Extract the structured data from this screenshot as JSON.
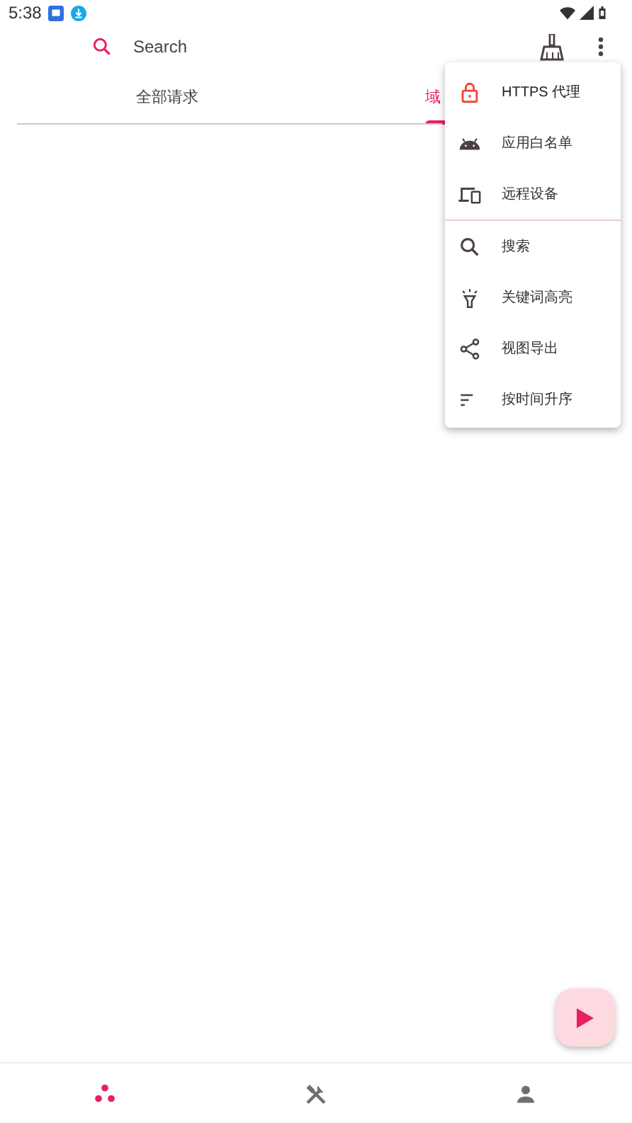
{
  "status_bar": {
    "time": "5:38"
  },
  "toolbar": {
    "search": {
      "placeholder": "Search"
    }
  },
  "tabs": [
    {
      "label": "全部请求",
      "selected": false
    },
    {
      "label": "域",
      "selected": true
    }
  ],
  "menu": {
    "sections": [
      {
        "items": [
          {
            "label": "HTTPS 代理",
            "kind": "lock"
          },
          {
            "label": "应用白名单",
            "kind": "android"
          },
          {
            "label": "远程设备",
            "kind": "devices"
          }
        ]
      },
      {
        "items": [
          {
            "label": "搜索",
            "kind": "search"
          },
          {
            "label": "关键词高亮",
            "kind": "highlight"
          },
          {
            "label": "视图导出",
            "kind": "share"
          },
          {
            "label": "按时间升序",
            "kind": "sort"
          }
        ]
      }
    ]
  },
  "bottom_nav": [
    {
      "kind": "dots",
      "selected": true
    },
    {
      "kind": "tools",
      "selected": false
    },
    {
      "kind": "person",
      "selected": false
    }
  ]
}
